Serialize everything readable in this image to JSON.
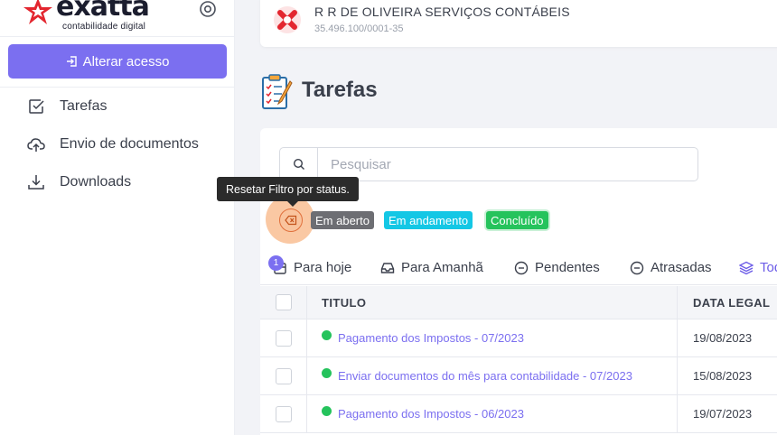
{
  "sidebar": {
    "logo_text": "exatta",
    "logo_subtitle": "contabilidade digital",
    "alter_button": "Alterar acesso",
    "nav": [
      {
        "label": "Tarefas",
        "icon": "checkbox-icon"
      },
      {
        "label": "Envio de documentos",
        "icon": "cloud-upload-icon"
      },
      {
        "label": "Downloads",
        "icon": "download-icon"
      }
    ]
  },
  "company": {
    "name": "R R DE OLIVEIRA SERVIÇOS CONTÁBEIS",
    "cnpj": "35.496.100/0001-35"
  },
  "page": {
    "title": "Tarefas"
  },
  "search": {
    "placeholder": "Pesquisar",
    "value": ""
  },
  "tooltip": "Resetar Filtro por status.",
  "status_filters": [
    {
      "label": "Em aberto",
      "color": "#6d6e73"
    },
    {
      "label": "Em andamento",
      "color": "#14c7e5"
    },
    {
      "label": "Concluído",
      "color": "#25c35c"
    }
  ],
  "tabs": [
    {
      "label": "Para hoje",
      "badge": "1",
      "icon": "calendar-icon"
    },
    {
      "label": "Para Amanhã",
      "icon": "inbox-icon"
    },
    {
      "label": "Pendentes",
      "icon": "minus-circle-icon"
    },
    {
      "label": "Atrasadas",
      "icon": "minus-circle-icon"
    },
    {
      "label": "Todas",
      "icon": "layers-icon"
    }
  ],
  "table": {
    "columns": [
      "TITULO",
      "DATA LEGAL"
    ],
    "rows": [
      {
        "title": "Pagamento dos Impostos - 07/2023",
        "date": "19/08/2023",
        "status_color": "#25c35c"
      },
      {
        "title": "Enviar documentos do mês para contabilidade - 07/2023",
        "date": "15/08/2023",
        "status_color": "#25c35c"
      },
      {
        "title": "Pagamento dos Impostos - 06/2023",
        "date": "19/07/2023",
        "status_color": "#25c35c"
      }
    ]
  },
  "colors": {
    "accent": "#7b6ff0",
    "brand_red": "#e3262f"
  }
}
